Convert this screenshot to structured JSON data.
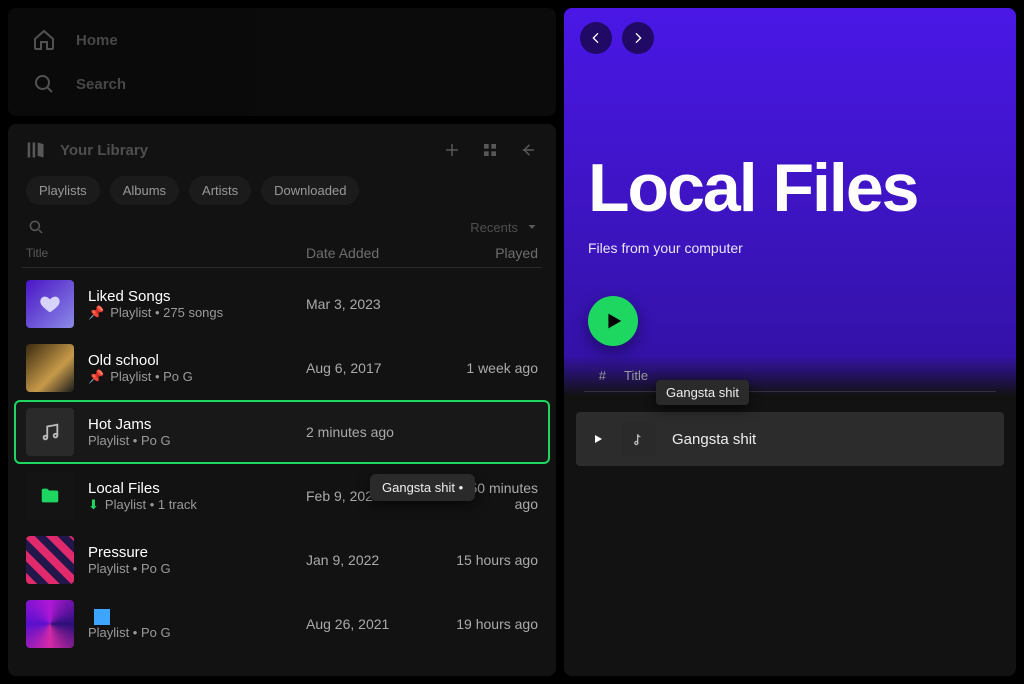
{
  "nav": {
    "home": "Home",
    "search": "Search"
  },
  "library": {
    "title": "Your Library",
    "chips": [
      "Playlists",
      "Albums",
      "Artists",
      "Downloaded"
    ],
    "sort_label": "Recents",
    "columns": {
      "title": "Title",
      "date": "Date Added",
      "played": "Played"
    },
    "rows": [
      {
        "title": "Liked Songs",
        "sub": "Playlist • 275 songs",
        "date": "Mar 3, 2023",
        "played": "",
        "pinned": true
      },
      {
        "title": "Old school",
        "sub": "Playlist • Po G",
        "date": "Aug 6, 2017",
        "played": "1 week ago",
        "pinned": true
      },
      {
        "title": "Hot Jams",
        "sub": "Playlist • Po G",
        "date": "2 minutes ago",
        "played": "",
        "pinned": false
      },
      {
        "title": "Local Files",
        "sub": "Playlist • 1 track",
        "date": "Feb 9, 2023",
        "played": "50 minutes ago",
        "pinned": false
      },
      {
        "title": "Pressure",
        "sub": "Playlist • Po G",
        "date": "Jan 9, 2022",
        "played": "15 hours ago",
        "pinned": false
      },
      {
        "title": "",
        "sub": "Playlist • Po G",
        "date": "Aug 26, 2021",
        "played": "19 hours ago",
        "pinned": false
      }
    ],
    "drag_pill": "Gangsta shit •"
  },
  "main": {
    "title": "Local Files",
    "subtitle": "Files from your computer",
    "track_columns": {
      "hash": "#",
      "title": "Title"
    },
    "tooltip": "Gangsta shit",
    "track": {
      "name": "Gangsta shit"
    }
  }
}
